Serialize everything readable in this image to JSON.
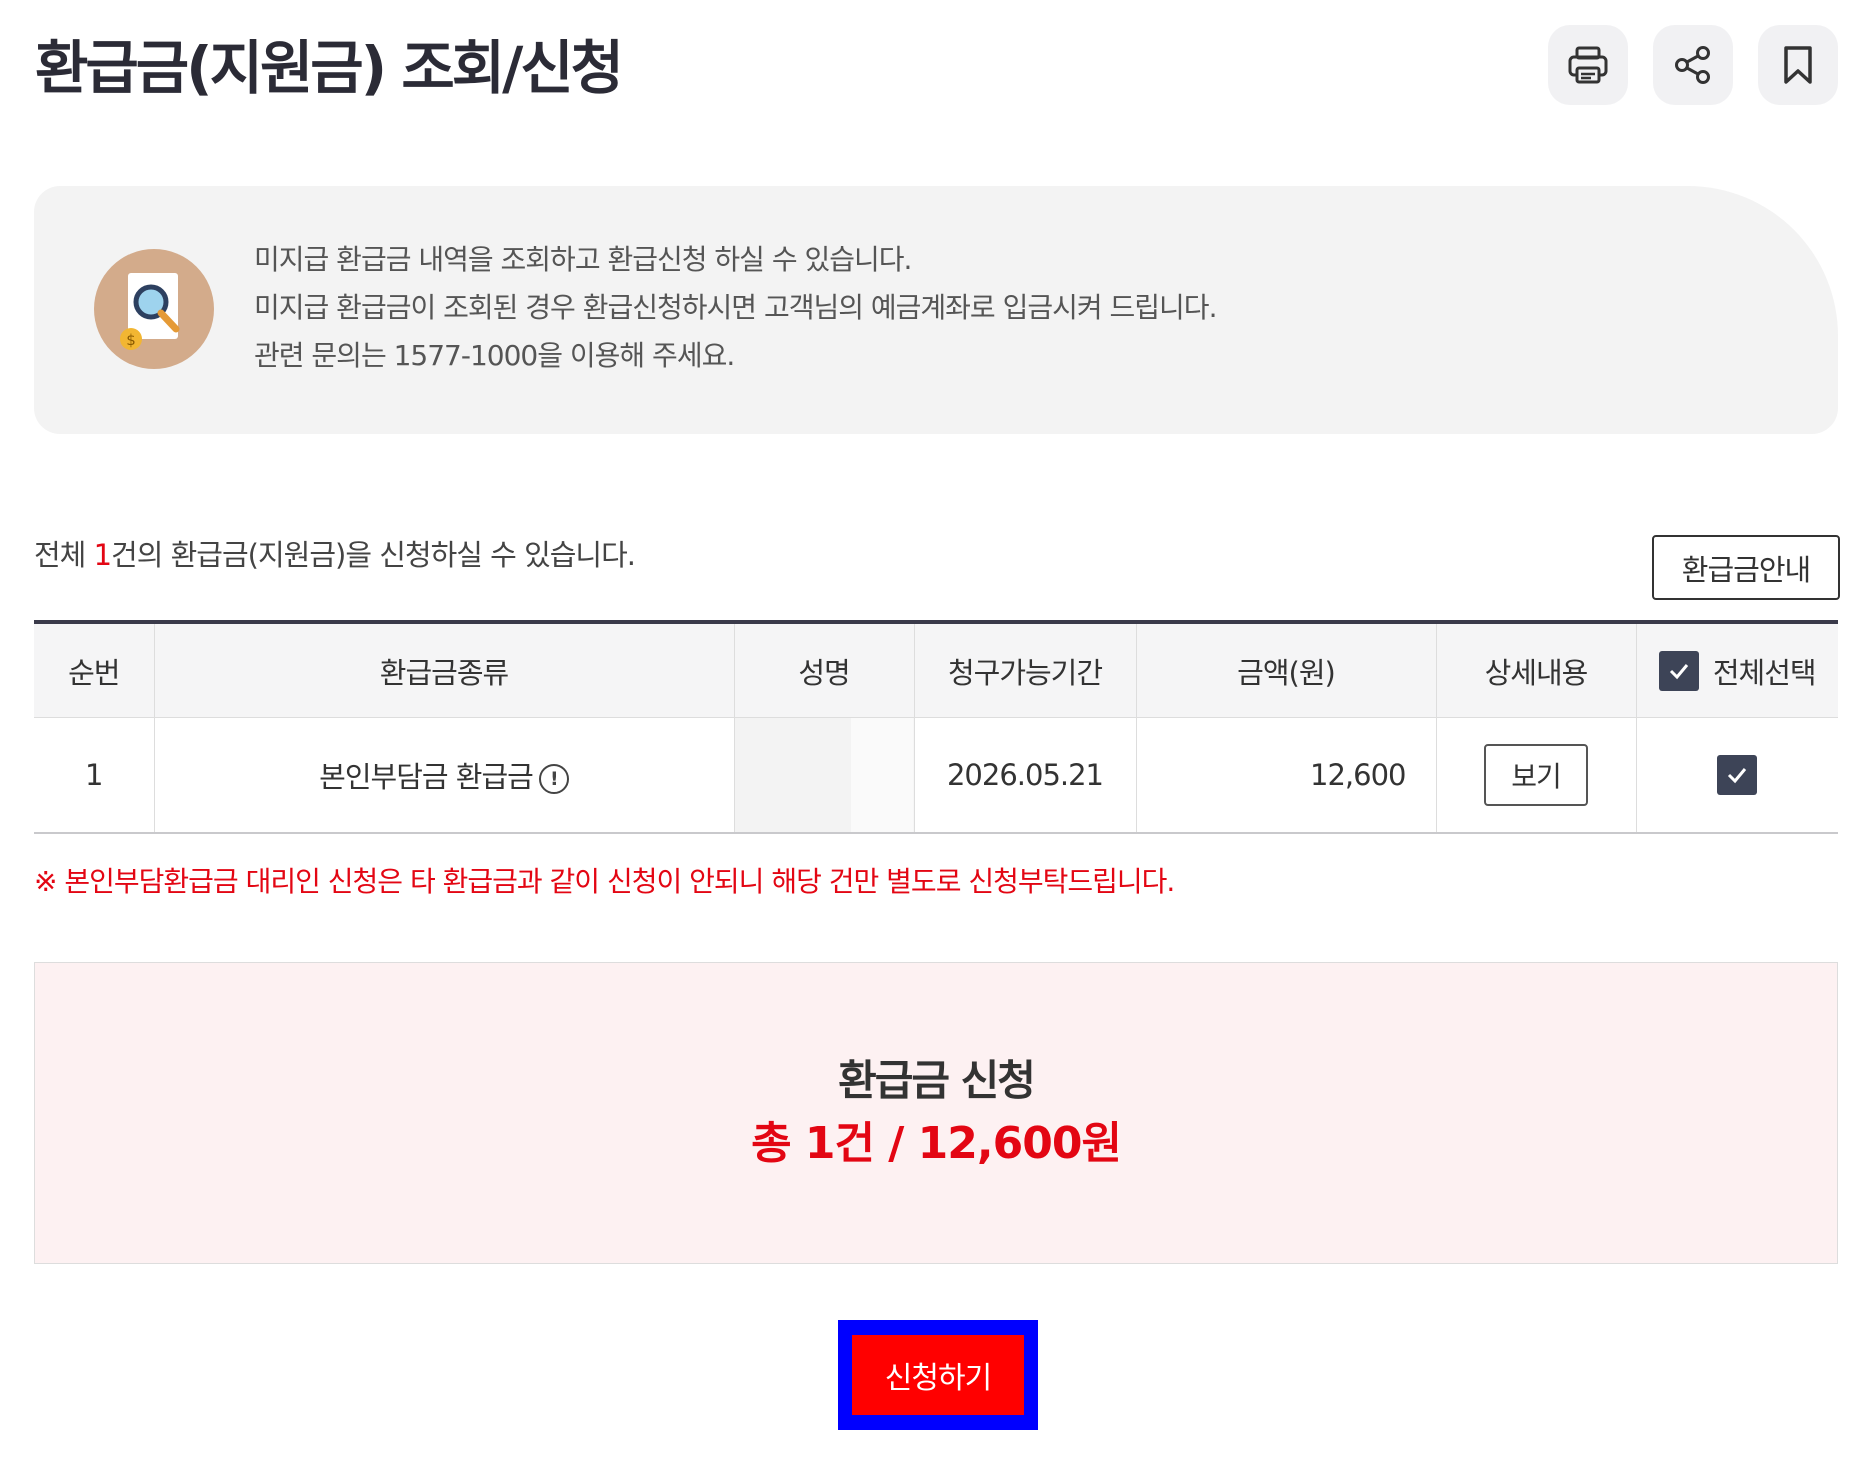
{
  "header": {
    "title": "환급금(지원금) 조회/신청",
    "actions": [
      {
        "icon": "print-icon"
      },
      {
        "icon": "share-icon"
      },
      {
        "icon": "bookmark-icon"
      }
    ]
  },
  "info": {
    "icon": "document-search-coin-icon",
    "lines": [
      "미지급 환급금 내역을 조회하고 환급신청 하실 수 있습니다.",
      "미지급 환급금이 조회된 경우 환급신청하시면 고객님의 예금계좌로 입금시켜 드립니다.",
      "관련 문의는 1577-1000을 이용해 주세요."
    ]
  },
  "summary": {
    "prefix": "전체 ",
    "count": "1",
    "suffix": "건의 환급금(지원금)을 신청하실 수 있습니다.",
    "guide_button": "환급금안내"
  },
  "table": {
    "headers": [
      "순번",
      "환급금종류",
      "성명",
      "청구가능기간",
      "금액(원)",
      "상세내용",
      "전체선택"
    ],
    "rows": [
      {
        "no": "1",
        "type": "본인부담금 환급금",
        "name": "",
        "period": "2026.05.21",
        "amount": "12,600",
        "detail_button": "보기",
        "checked": true
      }
    ]
  },
  "notice": "※ 본인부담환급금 대리인 신청은 타 환급금과 같이 신청이 안되니 해당 건만 별도로 신청부탁드립니다.",
  "apply": {
    "title": "환급금 신청",
    "total": "총 1건 / 12,600원",
    "submit_label": "신청하기"
  },
  "colors": {
    "accent_red": "#e30613",
    "title_dark": "#2b2b36",
    "checkbox": "#3d4457",
    "apply_bg": "#fdf1f2",
    "submit_border": "#0000ff",
    "submit_bg": "#ff0000"
  }
}
